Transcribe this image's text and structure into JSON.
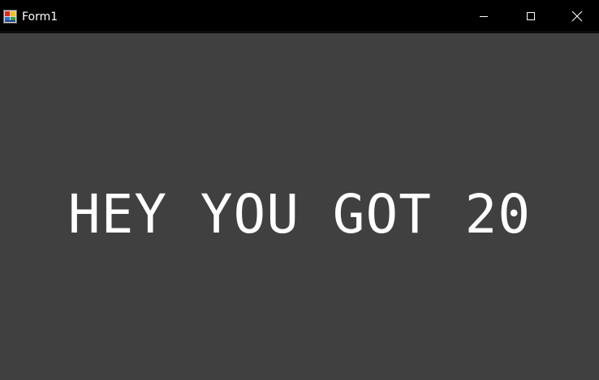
{
  "window": {
    "title": "Form1",
    "icon": "winforms-app-icon",
    "controls": {
      "minimize_icon": "minimize-icon",
      "maximize_icon": "maximize-icon",
      "close_icon": "close-icon"
    }
  },
  "client": {
    "message": "HEY YOU GOT 20",
    "background_color": "#404040",
    "text_color": "#ffffff"
  }
}
